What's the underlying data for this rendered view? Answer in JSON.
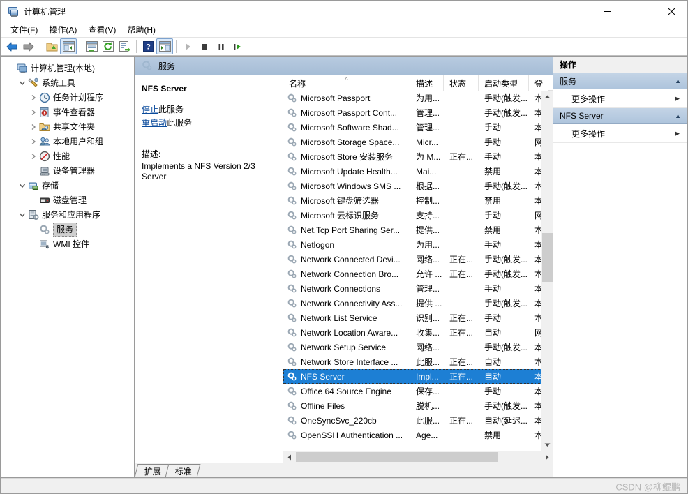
{
  "window": {
    "title": "计算机管理",
    "app_icon": "computer-management-icon",
    "minimize": "—",
    "maximize": "□",
    "close": "✕"
  },
  "menubar": {
    "items": [
      {
        "label": "文件(F)",
        "text": "文件",
        "accel": "F"
      },
      {
        "label": "操作(A)",
        "text": "操作",
        "accel": "A"
      },
      {
        "label": "查看(V)",
        "text": "查看",
        "accel": "V"
      },
      {
        "label": "帮助(H)",
        "text": "帮助",
        "accel": "H"
      }
    ]
  },
  "toolbar": {
    "buttons": [
      {
        "name": "back-icon",
        "kind": "arrow-left"
      },
      {
        "name": "forward-icon",
        "kind": "arrow-right"
      },
      {
        "name": "separator-1",
        "kind": "sep"
      },
      {
        "name": "up-one-level-icon",
        "kind": "folder-up"
      },
      {
        "name": "show-hide-console-tree-icon",
        "kind": "tree-pane",
        "active": true
      },
      {
        "name": "separator-2",
        "kind": "sep"
      },
      {
        "name": "properties-icon",
        "kind": "properties"
      },
      {
        "name": "refresh-icon",
        "kind": "refresh"
      },
      {
        "name": "export-list-icon",
        "kind": "export"
      },
      {
        "name": "separator-3",
        "kind": "sep"
      },
      {
        "name": "help-icon",
        "kind": "help"
      },
      {
        "name": "show-hide-action-pane-icon",
        "kind": "action-pane",
        "active": true
      },
      {
        "name": "separator-4",
        "kind": "sep"
      },
      {
        "name": "start-service-icon",
        "kind": "play"
      },
      {
        "name": "stop-service-icon",
        "kind": "stop"
      },
      {
        "name": "pause-service-icon",
        "kind": "pause"
      },
      {
        "name": "restart-service-icon",
        "kind": "restart"
      }
    ]
  },
  "tree": {
    "items": [
      {
        "label": "计算机管理(本地)",
        "depth": 0,
        "twisty": "",
        "icon": "computer-icon",
        "selected": false
      },
      {
        "label": "系统工具",
        "depth": 1,
        "twisty": "v",
        "icon": "system-tools-icon",
        "selected": false
      },
      {
        "label": "任务计划程序",
        "depth": 2,
        "twisty": ">",
        "icon": "task-scheduler-icon",
        "selected": false
      },
      {
        "label": "事件查看器",
        "depth": 2,
        "twisty": ">",
        "icon": "event-viewer-icon",
        "selected": false
      },
      {
        "label": "共享文件夹",
        "depth": 2,
        "twisty": ">",
        "icon": "shared-folders-icon",
        "selected": false
      },
      {
        "label": "本地用户和组",
        "depth": 2,
        "twisty": ">",
        "icon": "local-users-icon",
        "selected": false
      },
      {
        "label": "性能",
        "depth": 2,
        "twisty": ">",
        "icon": "performance-icon",
        "selected": false
      },
      {
        "label": "设备管理器",
        "depth": 2,
        "twisty": "",
        "icon": "device-manager-icon",
        "selected": false
      },
      {
        "label": "存储",
        "depth": 1,
        "twisty": "v",
        "icon": "storage-icon",
        "selected": false
      },
      {
        "label": "磁盘管理",
        "depth": 2,
        "twisty": "",
        "icon": "disk-management-icon",
        "selected": false
      },
      {
        "label": "服务和应用程序",
        "depth": 1,
        "twisty": "v",
        "icon": "services-apps-icon",
        "selected": false
      },
      {
        "label": "服务",
        "depth": 2,
        "twisty": "",
        "icon": "services-icon",
        "selected": true
      },
      {
        "label": "WMI 控件",
        "depth": 2,
        "twisty": "",
        "icon": "wmi-control-icon",
        "selected": false
      }
    ]
  },
  "console": {
    "header_title": "服务",
    "header_icon": "services-icon"
  },
  "detail": {
    "service_name": "NFS Server",
    "link_stop": {
      "underlined": "停止",
      "rest": "此服务"
    },
    "link_restart": {
      "underlined": "重启动",
      "rest": "此服务"
    },
    "description_label": "描述:",
    "description_text": "Implements a NFS Version 2/3 Server"
  },
  "list": {
    "columns": [
      {
        "key": "name",
        "label": "名称",
        "sorted": true,
        "sort_glyph": "^"
      },
      {
        "key": "desc",
        "label": "描述",
        "sorted": false
      },
      {
        "key": "state",
        "label": "状态",
        "sorted": false
      },
      {
        "key": "start",
        "label": "启动类型",
        "sorted": false
      },
      {
        "key": "logon",
        "label": "登",
        "sorted": false
      }
    ],
    "rows": [
      {
        "name": "Microsoft Passport",
        "desc": "为用...",
        "state": "",
        "start": "手动(触发...",
        "logon": "本",
        "selected": false
      },
      {
        "name": "Microsoft Passport Cont...",
        "desc": "管理...",
        "state": "",
        "start": "手动(触发...",
        "logon": "本",
        "selected": false
      },
      {
        "name": "Microsoft Software Shad...",
        "desc": "管理...",
        "state": "",
        "start": "手动",
        "logon": "本",
        "selected": false
      },
      {
        "name": "Microsoft Storage Space...",
        "desc": "Micr...",
        "state": "",
        "start": "手动",
        "logon": "网",
        "selected": false
      },
      {
        "name": "Microsoft Store 安装服务",
        "desc": "为 M...",
        "state": "正在...",
        "start": "手动",
        "logon": "本",
        "selected": false
      },
      {
        "name": "Microsoft Update Health...",
        "desc": "Mai...",
        "state": "",
        "start": "禁用",
        "logon": "本",
        "selected": false
      },
      {
        "name": "Microsoft Windows SMS ...",
        "desc": "根据...",
        "state": "",
        "start": "手动(触发...",
        "logon": "本",
        "selected": false
      },
      {
        "name": "Microsoft 键盘筛选器",
        "desc": "控制...",
        "state": "",
        "start": "禁用",
        "logon": "本",
        "selected": false
      },
      {
        "name": "Microsoft 云标识服务",
        "desc": "支持...",
        "state": "",
        "start": "手动",
        "logon": "网",
        "selected": false
      },
      {
        "name": "Net.Tcp Port Sharing Ser...",
        "desc": "提供...",
        "state": "",
        "start": "禁用",
        "logon": "本",
        "selected": false
      },
      {
        "name": "Netlogon",
        "desc": "为用...",
        "state": "",
        "start": "手动",
        "logon": "本",
        "selected": false
      },
      {
        "name": "Network Connected Devi...",
        "desc": "网络...",
        "state": "正在...",
        "start": "手动(触发...",
        "logon": "本",
        "selected": false
      },
      {
        "name": "Network Connection Bro...",
        "desc": "允许 ...",
        "state": "正在...",
        "start": "手动(触发...",
        "logon": "本",
        "selected": false
      },
      {
        "name": "Network Connections",
        "desc": "管理...",
        "state": "",
        "start": "手动",
        "logon": "本",
        "selected": false
      },
      {
        "name": "Network Connectivity Ass...",
        "desc": "提供 ...",
        "state": "",
        "start": "手动(触发...",
        "logon": "本",
        "selected": false
      },
      {
        "name": "Network List Service",
        "desc": "识别...",
        "state": "正在...",
        "start": "手动",
        "logon": "本",
        "selected": false
      },
      {
        "name": "Network Location Aware...",
        "desc": "收集...",
        "state": "正在...",
        "start": "自动",
        "logon": "网",
        "selected": false
      },
      {
        "name": "Network Setup Service",
        "desc": "网络...",
        "state": "",
        "start": "手动(触发...",
        "logon": "本",
        "selected": false
      },
      {
        "name": "Network Store Interface ...",
        "desc": "此服...",
        "state": "正在...",
        "start": "自动",
        "logon": "本",
        "selected": false
      },
      {
        "name": "NFS Server",
        "desc": "Impl...",
        "state": "正在...",
        "start": "自动",
        "logon": "本",
        "selected": true
      },
      {
        "name": "Office 64 Source Engine",
        "desc": "保存...",
        "state": "",
        "start": "手动",
        "logon": "本",
        "selected": false
      },
      {
        "name": "Offline Files",
        "desc": "脱机...",
        "state": "",
        "start": "手动(触发...",
        "logon": "本",
        "selected": false
      },
      {
        "name": "OneSyncSvc_220cb",
        "desc": "此服...",
        "state": "正在...",
        "start": "自动(延迟...",
        "logon": "本",
        "selected": false
      },
      {
        "name": "OpenSSH Authentication ...",
        "desc": "Age...",
        "state": "",
        "start": "禁用",
        "logon": "本",
        "selected": false
      }
    ],
    "vscroll": {
      "up": "⌃",
      "down": "⌄"
    },
    "hscroll": {
      "left": "❮",
      "right": "❯"
    }
  },
  "tabs": {
    "items": [
      {
        "label": "扩展",
        "active": false
      },
      {
        "label": "标准",
        "active": true
      }
    ]
  },
  "actions": {
    "title": "操作",
    "groups": [
      {
        "header": "服务",
        "chevron": "▲",
        "items": [
          {
            "label": "更多操作",
            "arrow": "▶"
          }
        ]
      },
      {
        "header": "NFS Server",
        "chevron": "▲",
        "items": [
          {
            "label": "更多操作",
            "arrow": "▶"
          }
        ]
      }
    ]
  },
  "statusbar": {
    "text": "",
    "watermark": "CSDN @柳鲲鹏"
  },
  "colors": {
    "selection_blue": "#1d7fd4",
    "header_gradient_top": "#b8cbe0",
    "header_gradient_bottom": "#a6bdd6",
    "link_blue": "#0b4b9c",
    "window_bg": "#f0f0f0"
  }
}
